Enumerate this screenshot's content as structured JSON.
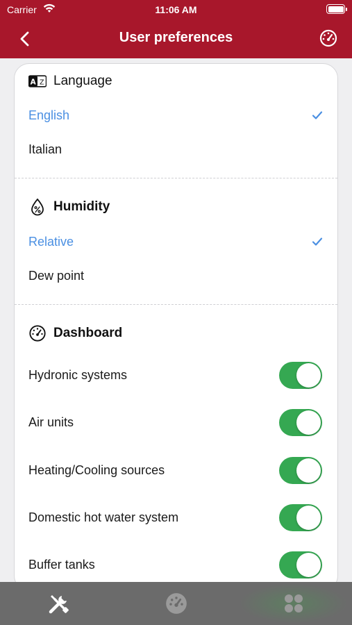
{
  "status_bar": {
    "carrier": "Carrier",
    "time": "11:06 AM"
  },
  "nav": {
    "title": "User preferences",
    "back_icon": "chevron-left-icon",
    "right_icon": "gauge-icon"
  },
  "sections": {
    "language": {
      "title": "Language",
      "icon": "language-icon",
      "icon_text": "A文",
      "options": [
        {
          "label": "English",
          "selected": true
        },
        {
          "label": "Italian",
          "selected": false
        }
      ]
    },
    "humidity": {
      "title": "Humidity",
      "icon": "humidity-drop-icon",
      "options": [
        {
          "label": "Relative",
          "selected": true
        },
        {
          "label": "Dew point",
          "selected": false
        }
      ]
    },
    "dashboard": {
      "title": "Dashboard",
      "icon": "gauge-icon",
      "toggles": [
        {
          "label": "Hydronic systems",
          "on": true
        },
        {
          "label": "Air units",
          "on": true
        },
        {
          "label": "Heating/Cooling sources",
          "on": true
        },
        {
          "label": "Domestic hot water system",
          "on": true
        },
        {
          "label": "Buffer tanks",
          "on": true
        }
      ]
    }
  },
  "tabbar": {
    "tabs": [
      {
        "icon": "tools-icon",
        "active": true
      },
      {
        "icon": "gauge-icon",
        "active": false
      },
      {
        "icon": "grid-icon",
        "active": false
      }
    ]
  },
  "colors": {
    "brand": "#a8172b",
    "accent": "#4a8fe2",
    "toggle_on": "#35a852",
    "tabbar": "#6b6b6b"
  }
}
